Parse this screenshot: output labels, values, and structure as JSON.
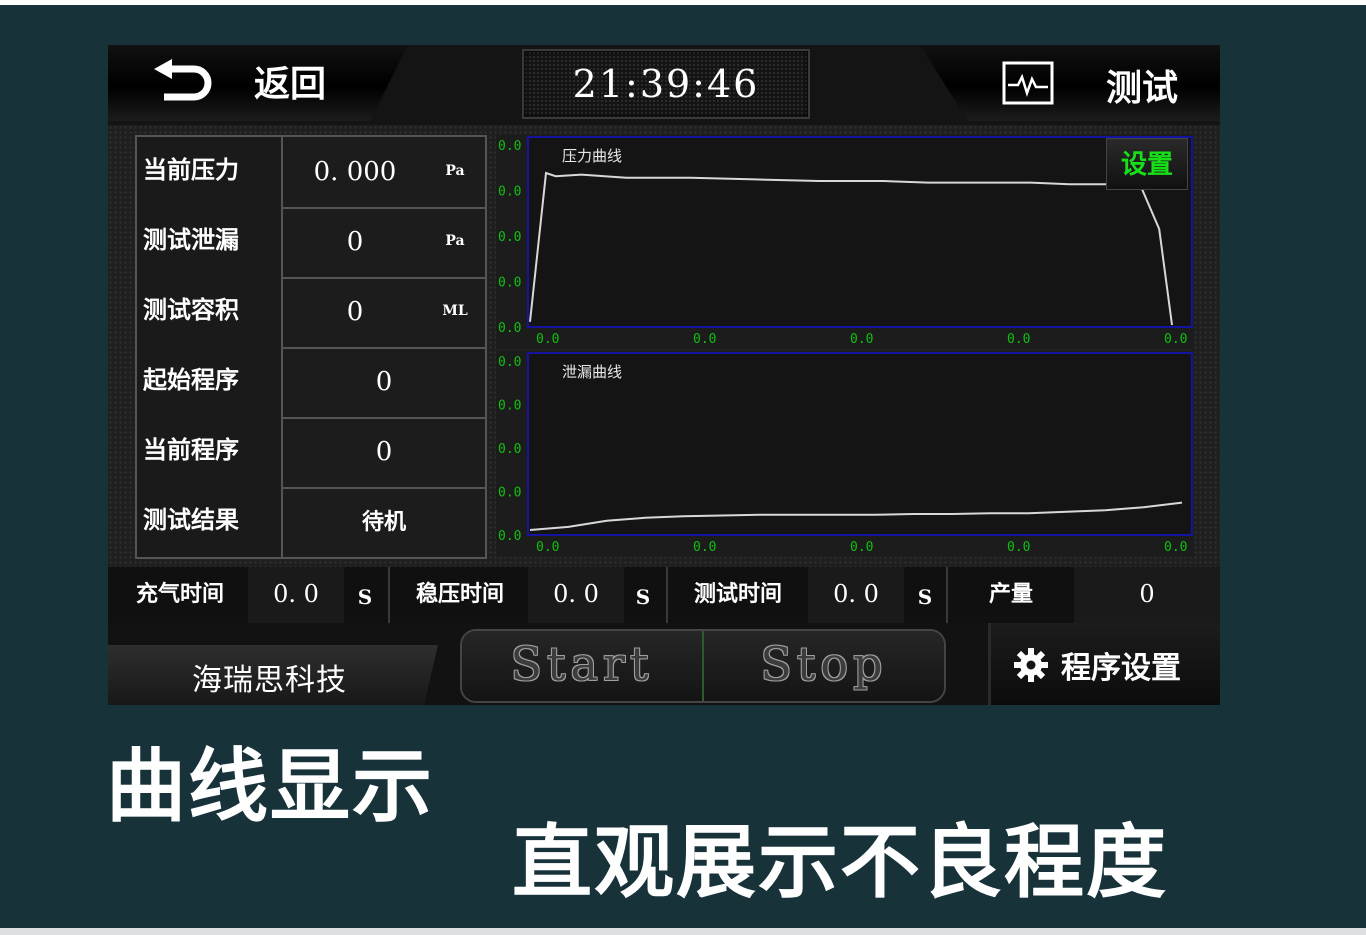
{
  "header": {
    "back_label": "返回",
    "clock": "21:39:46",
    "test_label": "测试"
  },
  "table": {
    "rows": [
      {
        "label": "当前压力",
        "value": "0. 000",
        "unit": "Pa"
      },
      {
        "label": "测试泄漏",
        "value": "0",
        "unit": "Pa"
      },
      {
        "label": "测试容积",
        "value": "0",
        "unit": "ML"
      },
      {
        "label": "起始程序",
        "value": "0",
        "unit": ""
      },
      {
        "label": "当前程序",
        "value": "0",
        "unit": ""
      },
      {
        "label": "测试结果",
        "value": "待机",
        "unit": ""
      }
    ]
  },
  "chart_data": [
    {
      "type": "line",
      "title": "压力曲线",
      "y_tick_labels": [
        "0.0",
        "0.0",
        "0.0",
        "0.0",
        "0.0"
      ],
      "x_tick_labels": [
        "0.0",
        "0.0",
        "0.0",
        "0.0",
        "0.0"
      ],
      "series": [
        {
          "values": [
            0.02,
            0.95,
            0.93,
            0.94,
            0.92,
            0.92,
            0.91,
            0.9,
            0.9,
            0.89,
            0.89,
            0.89,
            0.88,
            0.88,
            0.88,
            0.88,
            0.6,
            0.0
          ]
        }
      ],
      "line_color": "#d8d8d8",
      "axis_color": "#1414a0",
      "tick_color": "#10c010"
    },
    {
      "type": "line",
      "title": "泄漏曲线",
      "y_tick_labels": [
        "0.0",
        "0.0",
        "0.0",
        "0.0",
        "0.0"
      ],
      "x_tick_labels": [
        "0.0",
        "0.0",
        "0.0",
        "0.0",
        "0.0"
      ],
      "series": [
        {
          "values": [
            0.02,
            0.04,
            0.08,
            0.1,
            0.11,
            0.115,
            0.12,
            0.12,
            0.12,
            0.12,
            0.125,
            0.125,
            0.13,
            0.13,
            0.14,
            0.15,
            0.17,
            0.2
          ]
        }
      ],
      "line_color": "#d8d8d8",
      "axis_color": "#1414a0",
      "tick_color": "#10c010"
    }
  ],
  "settings_label": "设置",
  "timing": {
    "fill_label": "充气时间",
    "fill_value": "0. 0",
    "fill_unit": "S",
    "stable_label": "稳压时间",
    "stable_value": "0. 0",
    "stable_unit": "S",
    "test_label": "测试时间",
    "test_value": "0. 0",
    "test_unit": "S",
    "count_label": "产量",
    "count_value": "0"
  },
  "footer": {
    "brand": "海瑞思科技",
    "start_label": "Start",
    "stop_label": "Stop",
    "program_label": "程序设置"
  },
  "caption": {
    "line1": "曲线显示",
    "line2": "直观展示不良程度"
  }
}
